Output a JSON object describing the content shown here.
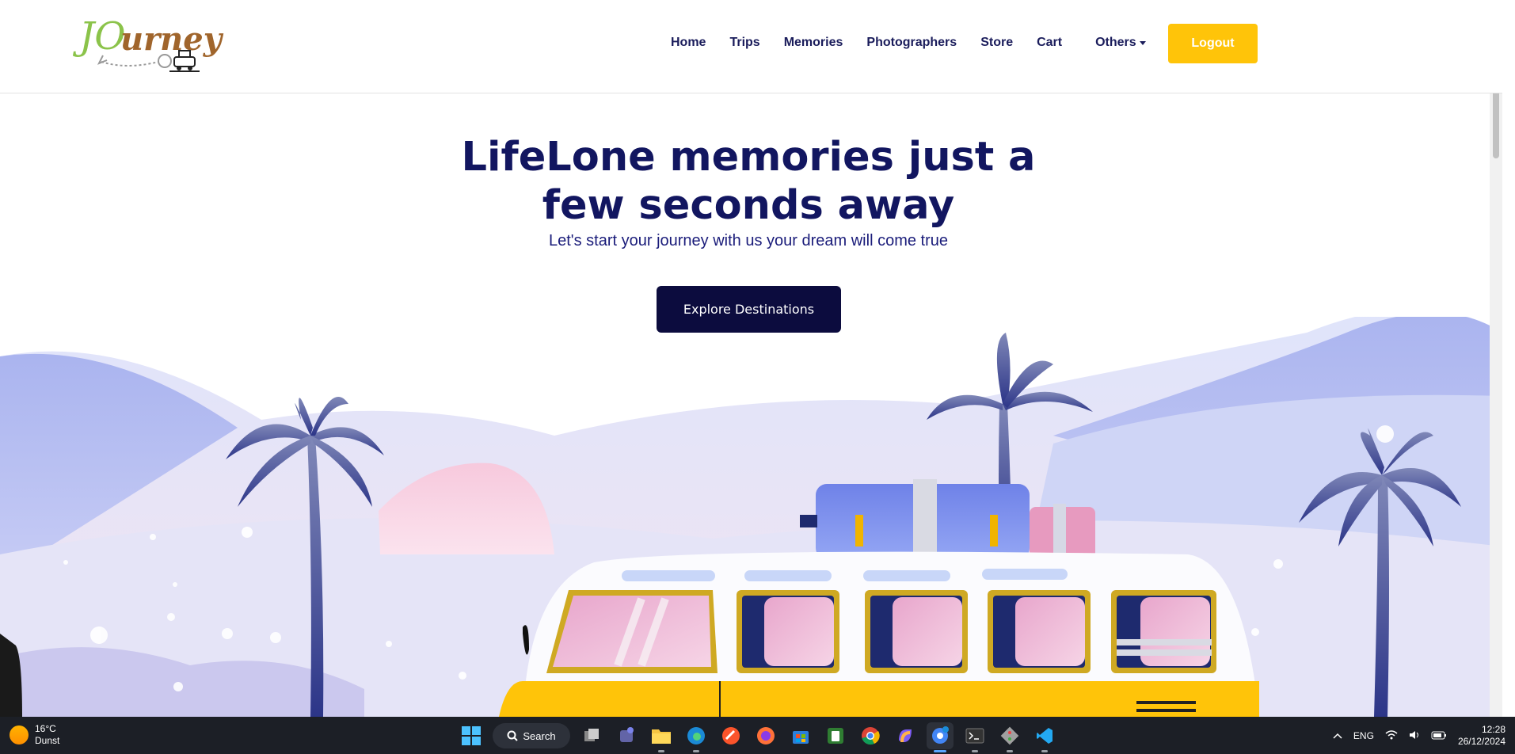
{
  "logo": {
    "text_j": "JO",
    "text_rest": "urney"
  },
  "nav": {
    "items": [
      "Home",
      "Trips",
      "Memories",
      "Photographers",
      "Store",
      "Cart"
    ],
    "others_label": "Others",
    "logout_label": "Logout"
  },
  "hero": {
    "title_line1": "LifeLone memories just a",
    "title_line2": "few seconds away",
    "subtitle": "Let's start your journey with us your dream will come true",
    "cta_label": "Explore Destinations"
  },
  "taskbar": {
    "weather_temp": "16°C",
    "weather_desc": "Dunst",
    "search_label": "Search",
    "language": "ENG",
    "time": "12:28",
    "date": "26/12/2024",
    "apps": [
      "start-icon",
      "search",
      "task-view-icon",
      "teams-icon",
      "file-explorer-icon",
      "edge-icon",
      "brave-icon",
      "firefox-icon",
      "store-icon",
      "solitaire-icon",
      "chrome-icon",
      "copilot-icon",
      "chrome-profile-icon",
      "terminal-icon",
      "git-icon",
      "vscode-icon"
    ]
  },
  "colors": {
    "brand_navy": "#121660",
    "accent_yellow": "#ffc409",
    "cta_bg": "#0c0c3e",
    "logo_green": "#8bc34a",
    "logo_brown": "#a0652c"
  }
}
